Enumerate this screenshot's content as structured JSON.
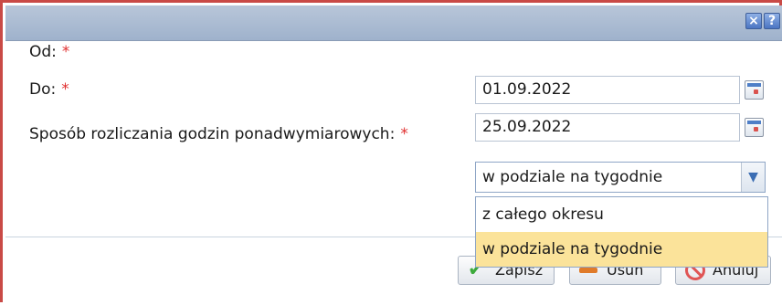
{
  "dialog": {
    "close_icon": "×",
    "help_icon": "?"
  },
  "form": {
    "od": {
      "label": "Od:",
      "required": "*",
      "value": "01.09.2022"
    },
    "do": {
      "label": "Do:",
      "required": "*",
      "value": "25.09.2022"
    },
    "sposob": {
      "label": "Sposób rozliczania godzin ponadwymiarowych:",
      "required": "*",
      "value": "w podziale na tygodnie",
      "options": [
        "z całego okresu",
        "w podziale na tygodnie"
      ]
    }
  },
  "buttons": {
    "save": "Zapisz",
    "delete": "Usuń",
    "cancel": "Anuluj"
  },
  "colors": {
    "titlebar": "#a9bad2",
    "border": "#c94a46",
    "highlight": "#fbe39a",
    "required": "#e03030"
  }
}
